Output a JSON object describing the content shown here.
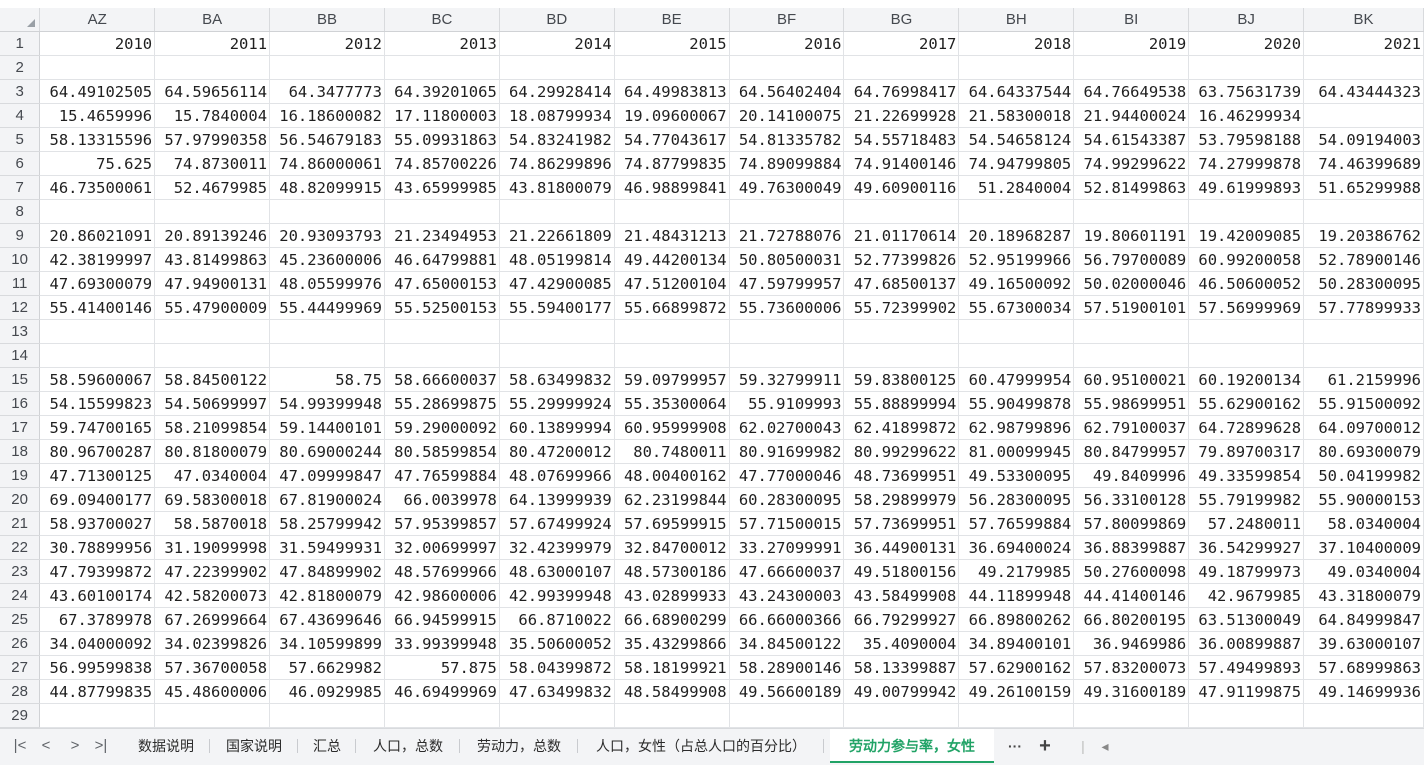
{
  "columns": [
    "AZ",
    "BA",
    "BB",
    "BC",
    "BD",
    "BE",
    "BF",
    "BG",
    "BH",
    "BI",
    "BJ",
    "BK"
  ],
  "rows": [
    {
      "n": "1",
      "c": [
        "2010",
        "2011",
        "2012",
        "2013",
        "2014",
        "2015",
        "2016",
        "2017",
        "2018",
        "2019",
        "2020",
        "2021"
      ]
    },
    {
      "n": "2",
      "c": [
        "",
        "",
        "",
        "",
        "",
        "",
        "",
        "",
        "",
        "",
        "",
        ""
      ]
    },
    {
      "n": "3",
      "c": [
        "64.49102505",
        "64.59656114",
        "64.3477773",
        "64.39201065",
        "64.29928414",
        "64.49983813",
        "64.56402404",
        "64.76998417",
        "64.64337544",
        "64.76649538",
        "63.75631739",
        "64.43444323"
      ]
    },
    {
      "n": "4",
      "c": [
        "15.4659996",
        "15.7840004",
        "16.18600082",
        "17.11800003",
        "18.08799934",
        "19.09600067",
        "20.14100075",
        "21.22699928",
        "21.58300018",
        "21.94400024",
        "16.46299934",
        ""
      ]
    },
    {
      "n": "5",
      "c": [
        "58.13315596",
        "57.97990358",
        "56.54679183",
        "55.09931863",
        "54.83241982",
        "54.77043617",
        "54.81335782",
        "54.55718483",
        "54.54658124",
        "54.61543387",
        "53.79598188",
        "54.09194003"
      ]
    },
    {
      "n": "6",
      "c": [
        "75.625",
        "74.8730011",
        "74.86000061",
        "74.85700226",
        "74.86299896",
        "74.87799835",
        "74.89099884",
        "74.91400146",
        "74.94799805",
        "74.99299622",
        "74.27999878",
        "74.46399689"
      ]
    },
    {
      "n": "7",
      "c": [
        "46.73500061",
        "52.4679985",
        "48.82099915",
        "43.65999985",
        "43.81800079",
        "46.98899841",
        "49.76300049",
        "49.60900116",
        "51.2840004",
        "52.81499863",
        "49.61999893",
        "51.65299988"
      ]
    },
    {
      "n": "8",
      "c": [
        "",
        "",
        "",
        "",
        "",
        "",
        "",
        "",
        "",
        "",
        "",
        ""
      ]
    },
    {
      "n": "9",
      "c": [
        "20.86021091",
        "20.89139246",
        "20.93093793",
        "21.23494953",
        "21.22661809",
        "21.48431213",
        "21.72788076",
        "21.01170614",
        "20.18968287",
        "19.80601191",
        "19.42009085",
        "19.20386762"
      ]
    },
    {
      "n": "10",
      "c": [
        "42.38199997",
        "43.81499863",
        "45.23600006",
        "46.64799881",
        "48.05199814",
        "49.44200134",
        "50.80500031",
        "52.77399826",
        "52.95199966",
        "56.79700089",
        "60.99200058",
        "52.78900146"
      ]
    },
    {
      "n": "11",
      "c": [
        "47.69300079",
        "47.94900131",
        "48.05599976",
        "47.65000153",
        "47.42900085",
        "47.51200104",
        "47.59799957",
        "47.68500137",
        "49.16500092",
        "50.02000046",
        "46.50600052",
        "50.28300095"
      ]
    },
    {
      "n": "12",
      "c": [
        "55.41400146",
        "55.47900009",
        "55.44499969",
        "55.52500153",
        "55.59400177",
        "55.66899872",
        "55.73600006",
        "55.72399902",
        "55.67300034",
        "57.51900101",
        "57.56999969",
        "57.77899933"
      ]
    },
    {
      "n": "13",
      "c": [
        "",
        "",
        "",
        "",
        "",
        "",
        "",
        "",
        "",
        "",
        "",
        ""
      ]
    },
    {
      "n": "14",
      "c": [
        "",
        "",
        "",
        "",
        "",
        "",
        "",
        "",
        "",
        "",
        "",
        ""
      ]
    },
    {
      "n": "15",
      "c": [
        "58.59600067",
        "58.84500122",
        "58.75",
        "58.66600037",
        "58.63499832",
        "59.09799957",
        "59.32799911",
        "59.83800125",
        "60.47999954",
        "60.95100021",
        "60.19200134",
        "61.2159996"
      ]
    },
    {
      "n": "16",
      "c": [
        "54.15599823",
        "54.50699997",
        "54.99399948",
        "55.28699875",
        "55.29999924",
        "55.35300064",
        "55.9109993",
        "55.88899994",
        "55.90499878",
        "55.98699951",
        "55.62900162",
        "55.91500092"
      ]
    },
    {
      "n": "17",
      "c": [
        "59.74700165",
        "58.21099854",
        "59.14400101",
        "59.29000092",
        "60.13899994",
        "60.95999908",
        "62.02700043",
        "62.41899872",
        "62.98799896",
        "62.79100037",
        "64.72899628",
        "64.09700012"
      ]
    },
    {
      "n": "18",
      "c": [
        "80.96700287",
        "80.81800079",
        "80.69000244",
        "80.58599854",
        "80.47200012",
        "80.7480011",
        "80.91699982",
        "80.99299622",
        "81.00099945",
        "80.84799957",
        "79.89700317",
        "80.69300079"
      ]
    },
    {
      "n": "19",
      "c": [
        "47.71300125",
        "47.0340004",
        "47.09999847",
        "47.76599884",
        "48.07699966",
        "48.00400162",
        "47.77000046",
        "48.73699951",
        "49.53300095",
        "49.8409996",
        "49.33599854",
        "50.04199982"
      ]
    },
    {
      "n": "20",
      "c": [
        "69.09400177",
        "69.58300018",
        "67.81900024",
        "66.0039978",
        "64.13999939",
        "62.23199844",
        "60.28300095",
        "58.29899979",
        "56.28300095",
        "56.33100128",
        "55.79199982",
        "55.90000153"
      ]
    },
    {
      "n": "21",
      "c": [
        "58.93700027",
        "58.5870018",
        "58.25799942",
        "57.95399857",
        "57.67499924",
        "57.69599915",
        "57.71500015",
        "57.73699951",
        "57.76599884",
        "57.80099869",
        "57.2480011",
        "58.0340004"
      ]
    },
    {
      "n": "22",
      "c": [
        "30.78899956",
        "31.19099998",
        "31.59499931",
        "32.00699997",
        "32.42399979",
        "32.84700012",
        "33.27099991",
        "36.44900131",
        "36.69400024",
        "36.88399887",
        "36.54299927",
        "37.10400009"
      ]
    },
    {
      "n": "23",
      "c": [
        "47.79399872",
        "47.22399902",
        "47.84899902",
        "48.57699966",
        "48.63000107",
        "48.57300186",
        "47.66600037",
        "49.51800156",
        "49.2179985",
        "50.27600098",
        "49.18799973",
        "49.0340004"
      ]
    },
    {
      "n": "24",
      "c": [
        "43.60100174",
        "42.58200073",
        "42.81800079",
        "42.98600006",
        "42.99399948",
        "43.02899933",
        "43.24300003",
        "43.58499908",
        "44.11899948",
        "44.41400146",
        "42.9679985",
        "43.31800079"
      ]
    },
    {
      "n": "25",
      "c": [
        "67.3789978",
        "67.26999664",
        "67.43699646",
        "66.94599915",
        "66.8710022",
        "66.68900299",
        "66.66000366",
        "66.79299927",
        "66.89800262",
        "66.80200195",
        "63.51300049",
        "64.84999847"
      ]
    },
    {
      "n": "26",
      "c": [
        "34.04000092",
        "34.02399826",
        "34.10599899",
        "33.99399948",
        "35.50600052",
        "35.43299866",
        "34.84500122",
        "35.4090004",
        "34.89400101",
        "36.9469986",
        "36.00899887",
        "39.63000107"
      ]
    },
    {
      "n": "27",
      "c": [
        "56.99599838",
        "57.36700058",
        "57.6629982",
        "57.875",
        "58.04399872",
        "58.18199921",
        "58.28900146",
        "58.13399887",
        "57.62900162",
        "57.83200073",
        "57.49499893",
        "57.68999863"
      ]
    },
    {
      "n": "28",
      "c": [
        "44.87799835",
        "45.48600006",
        "46.0929985",
        "46.69499969",
        "47.63499832",
        "48.58499908",
        "49.56600189",
        "49.00799942",
        "49.26100159",
        "49.31600189",
        "47.91199875",
        "49.14699936"
      ]
    },
    {
      "n": "29",
      "c": [
        "",
        "",
        "",
        "",
        "",
        "",
        "",
        "",
        "",
        "",
        "",
        ""
      ]
    }
  ],
  "tabs": [
    {
      "label": "数据说明",
      "active": false
    },
    {
      "label": "国家说明",
      "active": false
    },
    {
      "label": "汇总",
      "active": false
    },
    {
      "label": "人口，总数",
      "active": false
    },
    {
      "label": "劳动力，总数",
      "active": false
    },
    {
      "label": "人口，女性（占总人口的百分比）",
      "active": false
    },
    {
      "label": "劳动力参与率，女性",
      "active": true
    }
  ],
  "nav": {
    "first": "|<",
    "prev": "<",
    "next": ">",
    "last": ">|"
  },
  "tools": {
    "more": "···",
    "add": "+",
    "divider": "|",
    "scroll_left": "◂"
  },
  "colors": {
    "accent": "#21a366",
    "header_bg": "#f3f4f6",
    "gridline": "#e1e3e6"
  }
}
